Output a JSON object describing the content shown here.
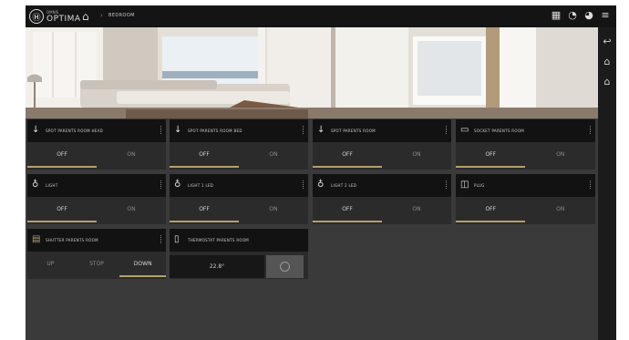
{
  "app": {
    "logo_letter": "Ⓗ",
    "logo_sub": "OMNIS",
    "logo_name": "OPTIMA",
    "breadcrumb": "BEDROOM"
  },
  "colors": {
    "accent": "#b5a06a",
    "card_bg": "#2b2b2b",
    "header_bg": "#121212",
    "screen_bg": "#3a3a3a"
  },
  "top_icons": [
    "scene-icon",
    "camera-icon",
    "alarm-icon",
    "menu-icon"
  ],
  "sidebar_icons": [
    "back-icon",
    "home-icon",
    "home-alt-icon"
  ],
  "cards": [
    {
      "label": "SPOT PARENTS ROOM HEAD",
      "icon": "↓",
      "icon_name": "spotlight-icon",
      "buttons": [
        "OFF",
        "ON"
      ],
      "state": "OFF"
    },
    {
      "label": "SPOT PARENTS ROOM BED",
      "icon": "↓",
      "icon_name": "spotlight-icon",
      "buttons": [
        "OFF",
        "ON"
      ],
      "state": "OFF"
    },
    {
      "label": "SPOT PARENTS ROOM",
      "icon": "↓",
      "icon_name": "spotlight-icon",
      "buttons": [
        "OFF",
        "ON"
      ],
      "state": "OFF"
    },
    {
      "label": "SOCKET PARENTS ROOM",
      "icon": "▭",
      "icon_name": "tv-socket-icon",
      "buttons": [
        "OFF",
        "ON"
      ],
      "state": "OFF"
    },
    {
      "label": "LIGHT",
      "icon": "♁",
      "icon_name": "bulb-icon",
      "buttons": [
        "OFF",
        "ON"
      ],
      "state": "OFF"
    },
    {
      "label": "LIGHT 1 LED",
      "icon": "♁",
      "icon_name": "bulb-icon",
      "buttons": [
        "OFF",
        "ON"
      ],
      "state": "OFF"
    },
    {
      "label": "LIGHT 2 LED",
      "icon": "♁",
      "icon_name": "bulb-icon",
      "buttons": [
        "OFF",
        "ON"
      ],
      "state": "OFF"
    },
    {
      "label": "PLUG",
      "icon": "◫",
      "icon_name": "plug-icon",
      "buttons": [
        "OFF",
        "ON"
      ],
      "state": "OFF"
    },
    {
      "label": "SHUTTER PARENTS ROOM",
      "icon": "▤",
      "icon_name": "shutter-icon",
      "buttons": [
        "UP",
        "STOP",
        "DOWN"
      ],
      "state": "DOWN"
    }
  ],
  "thermostat": {
    "label": "THERMOSTAT PARENTS ROOM",
    "icon": "▯",
    "icon_name": "thermometer-icon",
    "value": "22.8°"
  }
}
